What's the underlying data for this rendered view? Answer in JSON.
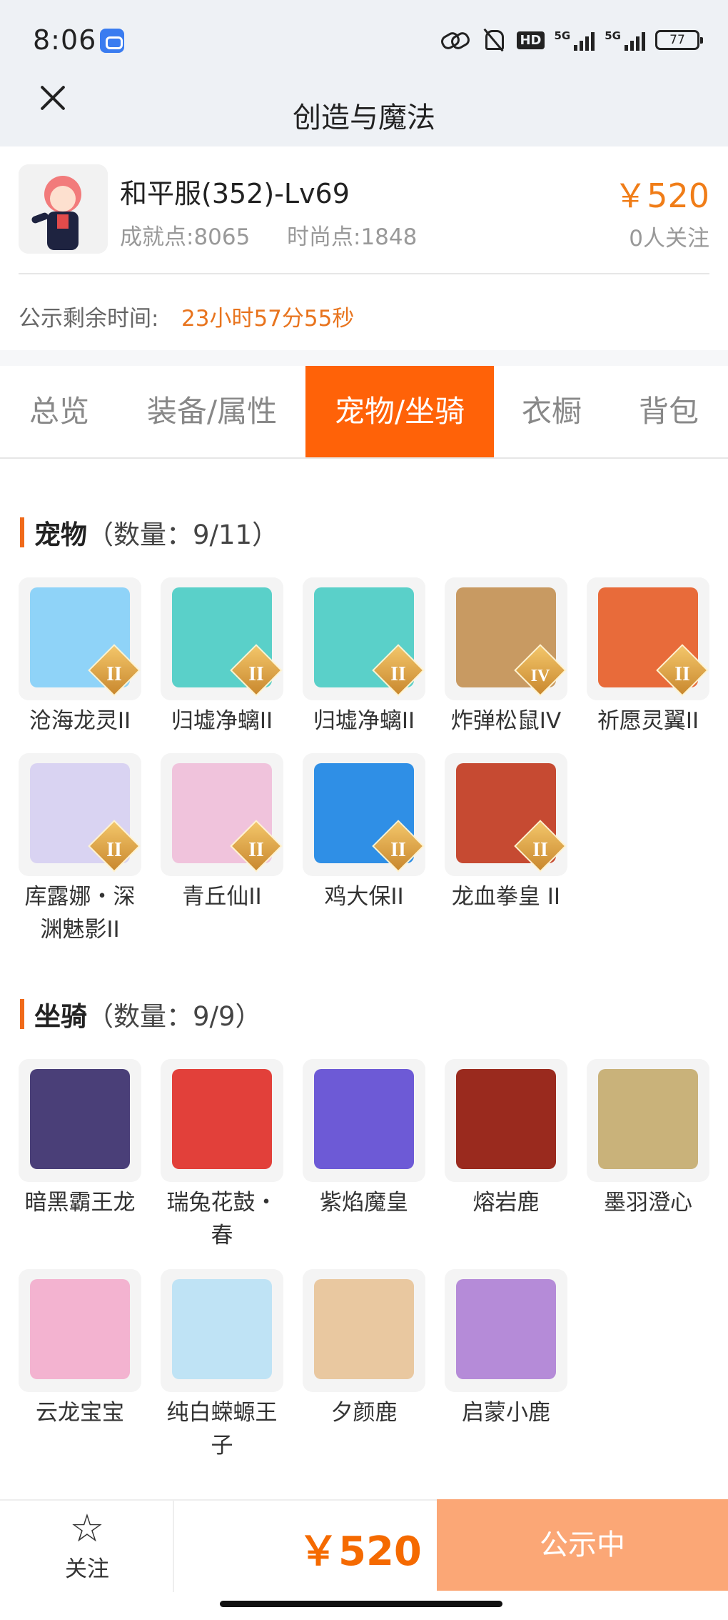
{
  "status_bar": {
    "time": "8:06",
    "hd_label": "HD",
    "signal_label_1": "5G",
    "signal_label_2": "5G",
    "battery": "77"
  },
  "nav": {
    "title": "创造与魔法"
  },
  "account": {
    "name": "和平服(352)-Lv69",
    "achievement": "成就点:8065",
    "fashion": "时尚点:1848",
    "price": "￥520",
    "followers": "0人关注",
    "countdown_label": "公示剩余时间:",
    "countdown_value": "23小时57分55秒"
  },
  "tabs": [
    {
      "label": "总览",
      "active": false
    },
    {
      "label": "装备/属性",
      "active": false
    },
    {
      "label": "宠物/坐骑",
      "active": true
    },
    {
      "label": "衣橱",
      "active": false
    },
    {
      "label": "背包",
      "active": false
    }
  ],
  "pets": {
    "title": "宠物",
    "count": "（数量：9/11）",
    "items": [
      {
        "name": "沧海龙灵II",
        "badge": "II",
        "color": "#8fd3f8"
      },
      {
        "name": "归墟净螭II",
        "badge": "II",
        "color": "#5ad0c9"
      },
      {
        "name": "归墟净螭II",
        "badge": "II",
        "color": "#5ad0c9"
      },
      {
        "name": "炸弹松鼠IV",
        "badge": "IV",
        "color": "#c89a62"
      },
      {
        "name": "祈愿灵翼II",
        "badge": "II",
        "color": "#e86b3a"
      },
      {
        "name": "库露娜・深渊魅影II",
        "badge": "II",
        "color": "#d9d3f2"
      },
      {
        "name": "青丘仙II",
        "badge": "II",
        "color": "#f0c3dc"
      },
      {
        "name": "鸡大保II",
        "badge": "II",
        "color": "#2f8fe6"
      },
      {
        "name": "龙血拳皇 II",
        "badge": "II",
        "color": "#c64a32"
      }
    ]
  },
  "mounts": {
    "title": "坐骑",
    "count": "（数量：9/9）",
    "items": [
      {
        "name": "暗黑霸王龙",
        "color": "#4a3f78"
      },
      {
        "name": "瑞兔花鼓・春",
        "color": "#e2403a"
      },
      {
        "name": "紫焰魔皇",
        "color": "#6d5ad6"
      },
      {
        "name": "熔岩鹿",
        "color": "#9a2a1e"
      },
      {
        "name": "墨羽澄心",
        "color": "#c9b27a"
      },
      {
        "name": "云龙宝宝",
        "color": "#f3b3d0"
      },
      {
        "name": "纯白蝾螈王子",
        "color": "#bfe3f5"
      },
      {
        "name": "夕颜鹿",
        "color": "#e9c8a0"
      },
      {
        "name": "启蒙小鹿",
        "color": "#b58bd8"
      }
    ]
  },
  "bottom": {
    "follow_label": "关注",
    "price": "￥520",
    "status_button": "公示中"
  }
}
